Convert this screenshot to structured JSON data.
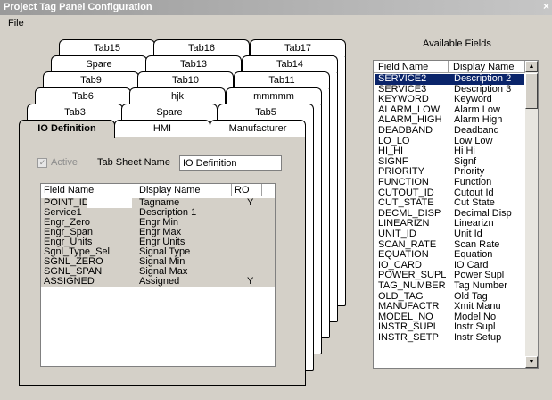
{
  "window": {
    "title": "Project Tag Panel Configuration",
    "close_glyph": "×"
  },
  "menu": {
    "file": "File"
  },
  "tabs": {
    "row5": [
      "Tab15",
      "Tab16",
      "Tab17"
    ],
    "row4": [
      "Spare",
      "Tab13",
      "Tab14"
    ],
    "row3": [
      "Tab9",
      "Tab10",
      "Tab11"
    ],
    "row2": [
      "Tab6",
      "hjk",
      "mmmmm"
    ],
    "row1": [
      "Tab3",
      "Spare",
      "Tab5"
    ],
    "row0": [
      "IO Definition",
      "HMI",
      "Manufacturer"
    ]
  },
  "panel": {
    "active_label": "Active",
    "active_checked": true,
    "tab_sheet_label": "Tab Sheet Name",
    "tab_sheet_value": "IO Definition",
    "columns": [
      "Field Name",
      "Display Name",
      "RO"
    ],
    "rows": [
      {
        "field": "POINT_ID",
        "display": "Tagname",
        "ro": "Y"
      },
      {
        "field": "Service1",
        "display": "Description 1",
        "ro": ""
      },
      {
        "field": "Engr_Zero",
        "display": "Engr Min",
        "ro": ""
      },
      {
        "field": "Engr_Span",
        "display": "Engr Max",
        "ro": ""
      },
      {
        "field": "Engr_Units",
        "display": "Engr Units",
        "ro": ""
      },
      {
        "field": "Sgnl_Type_Sel",
        "display": "Signal Type",
        "ro": ""
      },
      {
        "field": "SGNL_ZERO",
        "display": "Signal Min",
        "ro": ""
      },
      {
        "field": "SGNL_SPAN",
        "display": "Signal Max",
        "ro": ""
      },
      {
        "field": "ASSIGNED",
        "display": "Assigned",
        "ro": "Y"
      }
    ]
  },
  "available": {
    "title": "Available Fields",
    "columns": [
      "Field Name",
      "Display Name"
    ],
    "scroll_up": "▲",
    "scroll_down": "▼",
    "rows": [
      {
        "field": "SERVICE2",
        "display": "Description 2",
        "selected": true
      },
      {
        "field": "SERVICE3",
        "display": "Description 3"
      },
      {
        "field": "KEYWORD",
        "display": "Keyword"
      },
      {
        "field": "ALARM_LOW",
        "display": "Alarm Low"
      },
      {
        "field": "ALARM_HIGH",
        "display": "Alarm High"
      },
      {
        "field": "DEADBAND",
        "display": "Deadband"
      },
      {
        "field": "LO_LO",
        "display": "Low Low"
      },
      {
        "field": "HI_HI",
        "display": "Hi Hi"
      },
      {
        "field": "SIGNF",
        "display": "Signf"
      },
      {
        "field": "PRIORITY",
        "display": "Priority"
      },
      {
        "field": "FUNCTION",
        "display": "Function"
      },
      {
        "field": "CUTOUT_ID",
        "display": "Cutout Id"
      },
      {
        "field": "CUT_STATE",
        "display": "Cut State"
      },
      {
        "field": "DECML_DISP",
        "display": "Decimal Disp"
      },
      {
        "field": "LINEARIZN",
        "display": "Linearizn"
      },
      {
        "field": "UNIT_ID",
        "display": "Unit Id"
      },
      {
        "field": "SCAN_RATE",
        "display": "Scan Rate"
      },
      {
        "field": "EQUATION",
        "display": "Equation"
      },
      {
        "field": "IO_CARD",
        "display": "IO Card"
      },
      {
        "field": "POWER_SUPL",
        "display": "Power Supl"
      },
      {
        "field": "TAG_NUMBER",
        "display": "Tag Number"
      },
      {
        "field": "OLD_TAG",
        "display": "Old Tag"
      },
      {
        "field": "MANUFACTR",
        "display": "Xmit Manu"
      },
      {
        "field": "MODEL_NO",
        "display": "Model No"
      },
      {
        "field": "INSTR_SUPL",
        "display": "Instr Supl"
      },
      {
        "field": "INSTR_SETP",
        "display": "Instr Setup"
      }
    ]
  }
}
